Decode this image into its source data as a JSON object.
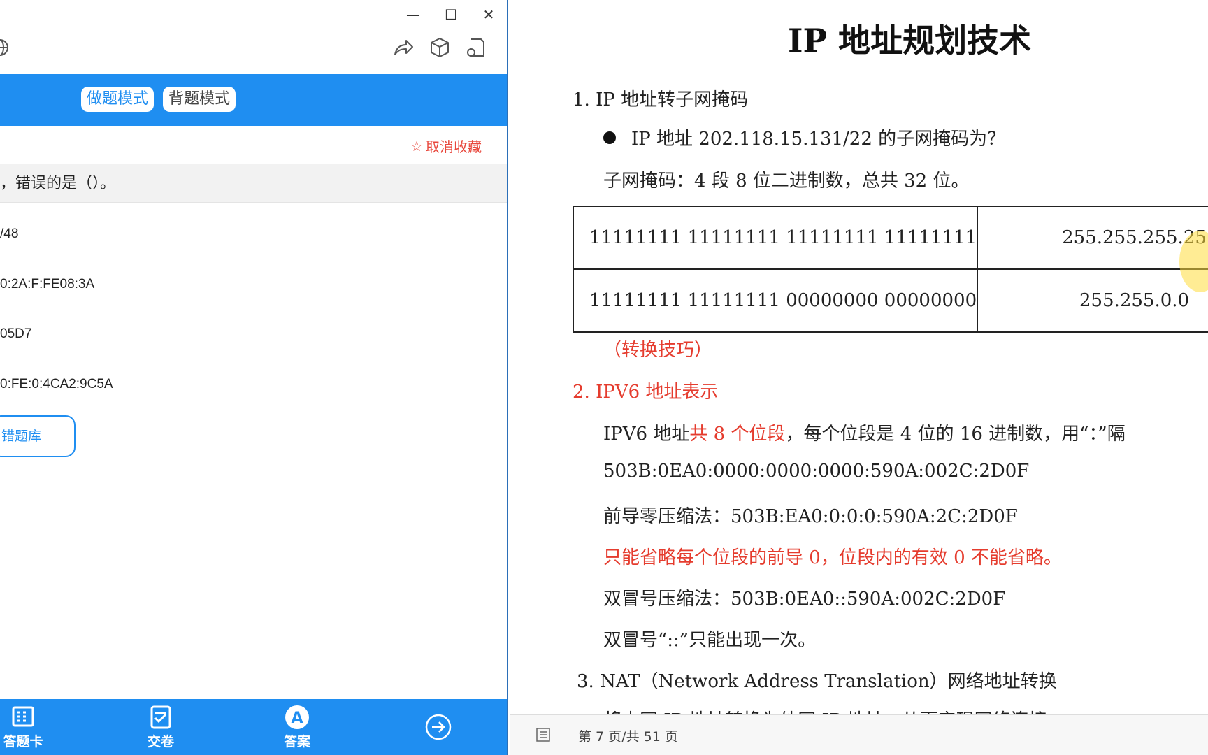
{
  "left_app": {
    "modes": {
      "practice": "做题模式",
      "memorize": "背题模式"
    },
    "favorite": {
      "icon": "star-icon",
      "label": "取消收藏"
    },
    "question_text": "，错误的是（）。",
    "options": [
      "/48",
      "0:2A:F:FE08:3A",
      "05D7",
      "0:FE:0:4CA2:9C5A"
    ],
    "wrong_bank_label": "错题库",
    "bottom_nav": [
      {
        "icon": "answer-card-icon",
        "label": "答题卡"
      },
      {
        "icon": "submit-paper-icon",
        "label": "交卷"
      },
      {
        "icon": "answer-icon",
        "label": "答案",
        "glyph": "A"
      }
    ],
    "accent_color": "#1f8ef1"
  },
  "window_controls": {
    "minimize": "—",
    "maximize": "☐",
    "close": "✕"
  },
  "doc": {
    "title": "IP 地址规划技术",
    "s1_heading": "1. IP 地址转子网掩码",
    "s1_bullet": "IP 地址 202.118.15.131/22 的子网掩码为？",
    "s1_note": "子网掩码：4 段 8 位二进制数，总共 32 位。",
    "table": [
      {
        "binary": "11111111 11111111 11111111 11111111",
        "decimal": "255.255.255.25"
      },
      {
        "binary": "11111111 11111111 00000000 00000000",
        "decimal": "255.255.0.0"
      }
    ],
    "tip": "（转换技巧）",
    "s2_heading": "2. IPV6 地址表示",
    "s2_desc_a": "IPV6 地址",
    "s2_desc_b": "共 8 个位段",
    "s2_desc_c": "，每个位段是 4 位的 16 进制数，用“：”隔",
    "full_addr": "503B:0EA0:0000:0000:0000:590A:002C:2D0F",
    "leading_zero": "前导零压缩法：503B:EA0:0:0:0:590A:2C:2D0F",
    "red_note": "只能省略每个位段的前导 0，位段内的有效 0 不能省略。",
    "double_colon": "双冒号压缩法：503B:0EA0::590A:002C:2D0F",
    "double_colon_note": "双冒号“::”只能出现一次。",
    "s3_heading": "3. NAT（Network Address Translation）网络地址转换",
    "s3_cut": "将内网 IP 地址转换为外网 IP 地址，从而实现网络连接"
  },
  "status": {
    "page_indicator": "第 7 页/共 51 页"
  },
  "colors": {
    "red_text": "#e53c2e",
    "highlight": "#ffdc3c"
  }
}
